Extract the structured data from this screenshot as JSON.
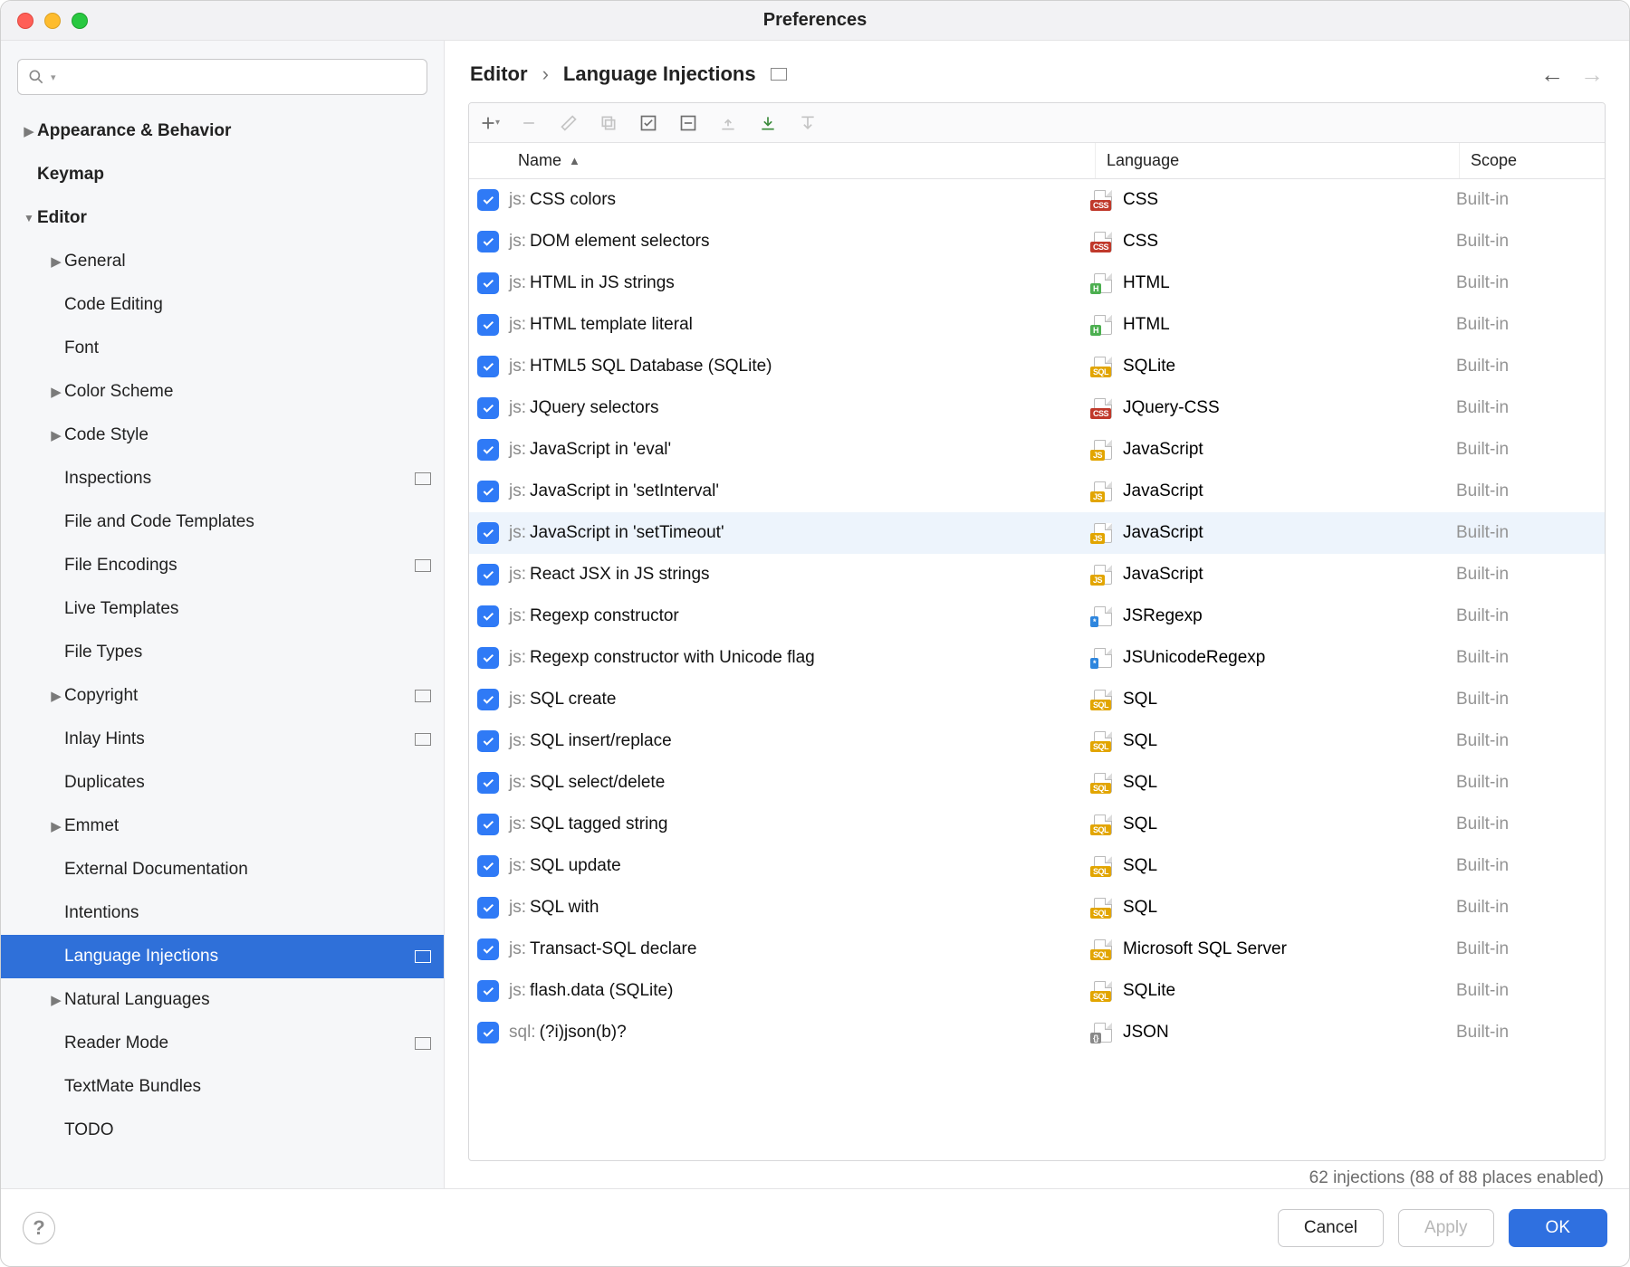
{
  "window": {
    "title": "Preferences"
  },
  "search": {
    "placeholder": ""
  },
  "sidebar": [
    {
      "label": "Appearance & Behavior",
      "indent": 0,
      "arrow": "right",
      "bold": true,
      "badge": false,
      "selected": false
    },
    {
      "label": "Keymap",
      "indent": 0,
      "arrow": "",
      "bold": true,
      "badge": false,
      "selected": false
    },
    {
      "label": "Editor",
      "indent": 0,
      "arrow": "down",
      "bold": true,
      "badge": false,
      "selected": false
    },
    {
      "label": "General",
      "indent": 1,
      "arrow": "right",
      "bold": false,
      "badge": false,
      "selected": false
    },
    {
      "label": "Code Editing",
      "indent": 1,
      "arrow": "",
      "bold": false,
      "badge": false,
      "selected": false
    },
    {
      "label": "Font",
      "indent": 1,
      "arrow": "",
      "bold": false,
      "badge": false,
      "selected": false
    },
    {
      "label": "Color Scheme",
      "indent": 1,
      "arrow": "right",
      "bold": false,
      "badge": false,
      "selected": false
    },
    {
      "label": "Code Style",
      "indent": 1,
      "arrow": "right",
      "bold": false,
      "badge": false,
      "selected": false
    },
    {
      "label": "Inspections",
      "indent": 1,
      "arrow": "",
      "bold": false,
      "badge": true,
      "selected": false
    },
    {
      "label": "File and Code Templates",
      "indent": 1,
      "arrow": "",
      "bold": false,
      "badge": false,
      "selected": false
    },
    {
      "label": "File Encodings",
      "indent": 1,
      "arrow": "",
      "bold": false,
      "badge": true,
      "selected": false
    },
    {
      "label": "Live Templates",
      "indent": 1,
      "arrow": "",
      "bold": false,
      "badge": false,
      "selected": false
    },
    {
      "label": "File Types",
      "indent": 1,
      "arrow": "",
      "bold": false,
      "badge": false,
      "selected": false
    },
    {
      "label": "Copyright",
      "indent": 1,
      "arrow": "right",
      "bold": false,
      "badge": true,
      "selected": false
    },
    {
      "label": "Inlay Hints",
      "indent": 1,
      "arrow": "",
      "bold": false,
      "badge": true,
      "selected": false
    },
    {
      "label": "Duplicates",
      "indent": 1,
      "arrow": "",
      "bold": false,
      "badge": false,
      "selected": false
    },
    {
      "label": "Emmet",
      "indent": 1,
      "arrow": "right",
      "bold": false,
      "badge": false,
      "selected": false
    },
    {
      "label": "External Documentation",
      "indent": 1,
      "arrow": "",
      "bold": false,
      "badge": false,
      "selected": false
    },
    {
      "label": "Intentions",
      "indent": 1,
      "arrow": "",
      "bold": false,
      "badge": false,
      "selected": false
    },
    {
      "label": "Language Injections",
      "indent": 1,
      "arrow": "",
      "bold": false,
      "badge": true,
      "selected": true
    },
    {
      "label": "Natural Languages",
      "indent": 1,
      "arrow": "right",
      "bold": false,
      "badge": false,
      "selected": false
    },
    {
      "label": "Reader Mode",
      "indent": 1,
      "arrow": "",
      "bold": false,
      "badge": true,
      "selected": false
    },
    {
      "label": "TextMate Bundles",
      "indent": 1,
      "arrow": "",
      "bold": false,
      "badge": false,
      "selected": false
    },
    {
      "label": "TODO",
      "indent": 1,
      "arrow": "",
      "bold": false,
      "badge": false,
      "selected": false
    }
  ],
  "breadcrumb": {
    "a": "Editor",
    "b": "Language Injections"
  },
  "columns": {
    "name": "Name",
    "language": "Language",
    "scope": "Scope"
  },
  "rows": [
    {
      "checked": true,
      "prefix": "js:",
      "name": " CSS colors",
      "lang": "CSS",
      "tag": "CSS",
      "tagColor": "#c0392b",
      "scope": "Built-in",
      "hl": false
    },
    {
      "checked": true,
      "prefix": "js:",
      "name": " DOM element selectors",
      "lang": "CSS",
      "tag": "CSS",
      "tagColor": "#c0392b",
      "scope": "Built-in",
      "hl": false
    },
    {
      "checked": true,
      "prefix": "js:",
      "name": " HTML in JS strings",
      "lang": "HTML",
      "tag": "H",
      "tagColor": "#4caf50",
      "scope": "Built-in",
      "hl": false
    },
    {
      "checked": true,
      "prefix": "js:",
      "name": " HTML template literal",
      "lang": "HTML",
      "tag": "H",
      "tagColor": "#4caf50",
      "scope": "Built-in",
      "hl": false
    },
    {
      "checked": true,
      "prefix": "js:",
      "name": " HTML5 SQL Database (SQLite)",
      "lang": "SQLite",
      "tag": "SQL",
      "tagColor": "#e2a500",
      "scope": "Built-in",
      "hl": false
    },
    {
      "checked": true,
      "prefix": "js:",
      "name": " JQuery selectors",
      "lang": "JQuery-CSS",
      "tag": "CSS",
      "tagColor": "#c0392b",
      "scope": "Built-in",
      "hl": false
    },
    {
      "checked": true,
      "prefix": "js:",
      "name": " JavaScript in 'eval'",
      "lang": "JavaScript",
      "tag": "JS",
      "tagColor": "#e2a500",
      "scope": "Built-in",
      "hl": false
    },
    {
      "checked": true,
      "prefix": "js:",
      "name": " JavaScript in 'setInterval'",
      "lang": "JavaScript",
      "tag": "JS",
      "tagColor": "#e2a500",
      "scope": "Built-in",
      "hl": false
    },
    {
      "checked": true,
      "prefix": "js:",
      "name": " JavaScript in 'setTimeout'",
      "lang": "JavaScript",
      "tag": "JS",
      "tagColor": "#e2a500",
      "scope": "Built-in",
      "hl": true
    },
    {
      "checked": true,
      "prefix": "js:",
      "name": " React JSX in JS strings",
      "lang": "JavaScript",
      "tag": "JS",
      "tagColor": "#e2a500",
      "scope": "Built-in",
      "hl": false
    },
    {
      "checked": true,
      "prefix": "js:",
      "name": " Regexp constructor",
      "lang": "JSRegexp",
      "tag": "*",
      "tagColor": "#2e86de",
      "scope": "Built-in",
      "hl": false
    },
    {
      "checked": true,
      "prefix": "js:",
      "name": " Regexp constructor with Unicode flag",
      "lang": "JSUnicodeRegexp",
      "tag": "*",
      "tagColor": "#2e86de",
      "scope": "Built-in",
      "hl": false
    },
    {
      "checked": true,
      "prefix": "js:",
      "name": " SQL create",
      "lang": "SQL",
      "tag": "SQL",
      "tagColor": "#e2a500",
      "scope": "Built-in",
      "hl": false
    },
    {
      "checked": true,
      "prefix": "js:",
      "name": " SQL insert/replace",
      "lang": "SQL",
      "tag": "SQL",
      "tagColor": "#e2a500",
      "scope": "Built-in",
      "hl": false
    },
    {
      "checked": true,
      "prefix": "js:",
      "name": " SQL select/delete",
      "lang": "SQL",
      "tag": "SQL",
      "tagColor": "#e2a500",
      "scope": "Built-in",
      "hl": false
    },
    {
      "checked": true,
      "prefix": "js:",
      "name": " SQL tagged string",
      "lang": "SQL",
      "tag": "SQL",
      "tagColor": "#e2a500",
      "scope": "Built-in",
      "hl": false
    },
    {
      "checked": true,
      "prefix": "js:",
      "name": " SQL update",
      "lang": "SQL",
      "tag": "SQL",
      "tagColor": "#e2a500",
      "scope": "Built-in",
      "hl": false
    },
    {
      "checked": true,
      "prefix": "js:",
      "name": " SQL with",
      "lang": "SQL",
      "tag": "SQL",
      "tagColor": "#e2a500",
      "scope": "Built-in",
      "hl": false
    },
    {
      "checked": true,
      "prefix": "js:",
      "name": " Transact-SQL declare",
      "lang": "Microsoft SQL Server",
      "tag": "SQL",
      "tagColor": "#e2a500",
      "scope": "Built-in",
      "hl": false
    },
    {
      "checked": true,
      "prefix": "js:",
      "name": " flash.data (SQLite)",
      "lang": "SQLite",
      "tag": "SQL",
      "tagColor": "#e2a500",
      "scope": "Built-in",
      "hl": false
    },
    {
      "checked": true,
      "prefix": "sql:",
      "name": " (?i)json(b)?",
      "lang": "JSON",
      "tag": "{}",
      "tagColor": "#888888",
      "scope": "Built-in",
      "hl": false
    }
  ],
  "status": "62 injections (88 of 88 places enabled)",
  "buttons": {
    "cancel": "Cancel",
    "apply": "Apply",
    "ok": "OK"
  }
}
